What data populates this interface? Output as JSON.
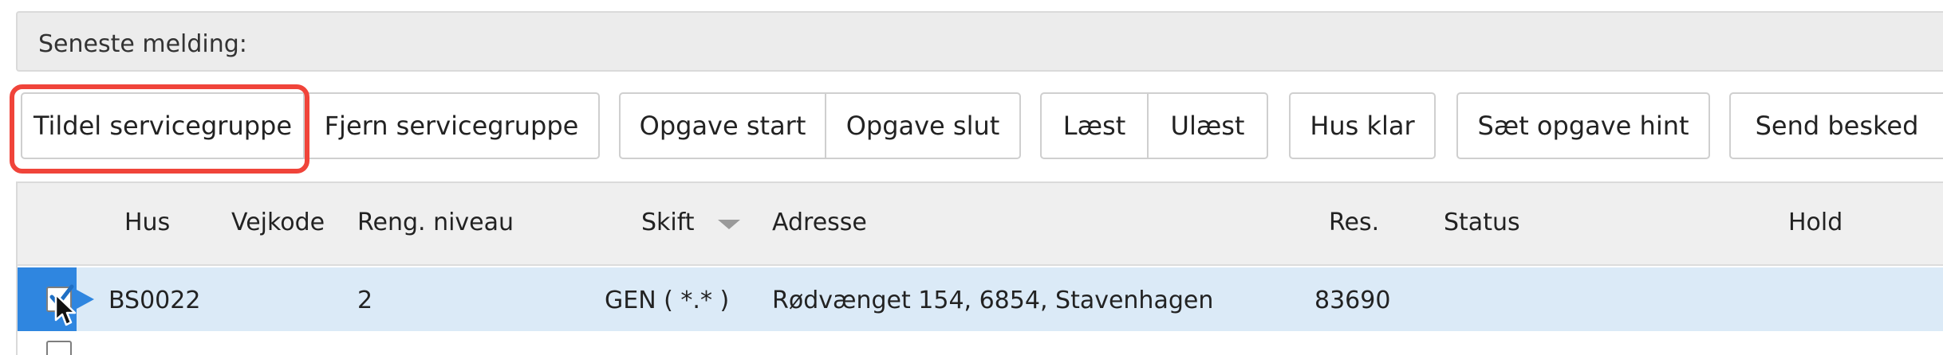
{
  "message_bar": {
    "label": "Seneste melding:"
  },
  "toolbar": {
    "assign_service_group": "Tildel servicegruppe",
    "remove_service_group": "Fjern servicegruppe",
    "task_start": "Opgave start",
    "task_end": "Opgave slut",
    "read": "Læst",
    "unread": "Ulæst",
    "house_ready": "Hus klar",
    "set_task_hint": "Sæt opgave hint",
    "send_message": "Send besked"
  },
  "grid": {
    "columns": {
      "hus": "Hus",
      "vejkode": "Vejkode",
      "reng_niveau": "Reng. niveau",
      "skift": "Skift",
      "adresse": "Adresse",
      "res": "Res.",
      "status": "Status",
      "hold": "Hold"
    },
    "sort_icon": "sort-desc-icon",
    "rows": [
      {
        "selected": true,
        "hus": "BS0022",
        "vejkode": "",
        "reng_niveau": "2",
        "skift": "GEN ( *.* )",
        "adresse": "Rødvænget 154, 6854, Stavenhagen",
        "res": "83690",
        "status": "",
        "hold": ""
      }
    ]
  },
  "colors": {
    "highlight": "#f0443a",
    "selected_row": "#dbeaf7",
    "selection_marker": "#2f86e0"
  }
}
